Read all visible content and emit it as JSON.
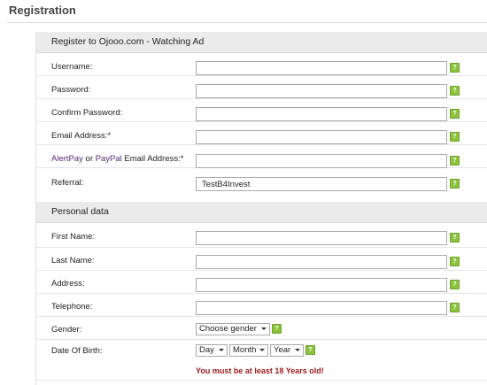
{
  "page": {
    "title": "Registration"
  },
  "account_section": {
    "header": "Register to Ojooo.com - Watching Ad",
    "fields": {
      "username": {
        "label": "Username:",
        "value": ""
      },
      "password": {
        "label": "Password:",
        "value": ""
      },
      "confirm_password": {
        "label": "Confirm Password:",
        "value": ""
      },
      "email": {
        "label": "Email Address:*",
        "value": ""
      },
      "payout_email": {
        "label_link1": "AlertPay",
        "label_or": " or ",
        "label_link2": "PayPal",
        "label_rest": " Email Address:*",
        "value": ""
      },
      "referral": {
        "label": "Referral:",
        "value": "TestB4Invest"
      }
    }
  },
  "personal_section": {
    "header": "Personal data",
    "fields": {
      "first_name": {
        "label": "First Name:",
        "value": ""
      },
      "last_name": {
        "label": "Last Name:",
        "value": ""
      },
      "address": {
        "label": "Address:",
        "value": ""
      },
      "telephone": {
        "label": "Telephone:",
        "value": ""
      },
      "gender": {
        "label": "Gender:",
        "selected": "Choose gender"
      },
      "dob": {
        "label": "Date Of Birth:",
        "day": "Day",
        "month": "Month",
        "year": "Year"
      }
    },
    "age_warning": "You must be at least 18 Years old!"
  },
  "help_icon_glyph": "?",
  "icons": {
    "help": "help-question-icon"
  },
  "colors": {
    "help_icon": "#8cc23e",
    "warning": "#a01c1c",
    "link": "#5a2a7a"
  }
}
